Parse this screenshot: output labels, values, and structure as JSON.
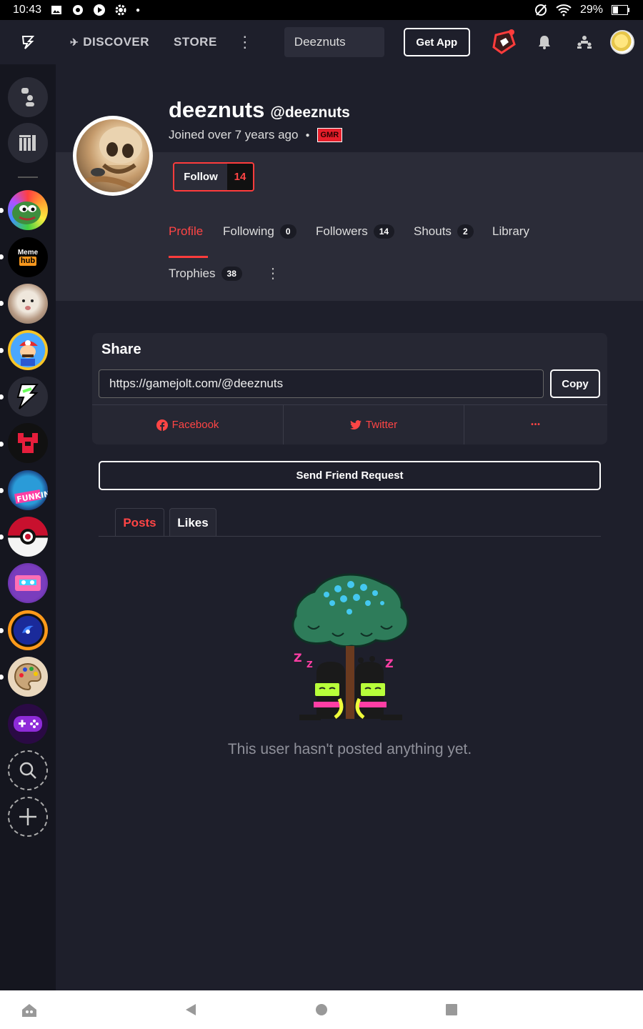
{
  "status_bar": {
    "time": "10:43",
    "battery": "29%"
  },
  "top_nav": {
    "discover_label": "DISCOVER",
    "store_label": "STORE",
    "search_value": "Deeznuts",
    "get_app_label": "Get App"
  },
  "sidebar": {
    "items": [
      {
        "name": "Meme hub",
        "label_line1": "Meme",
        "label_line2": "hub"
      }
    ]
  },
  "profile": {
    "display_name": "deeznuts",
    "handle": "@deeznuts",
    "joined": "Joined over 7 years ago",
    "badge": "GMR",
    "follow_label": "Follow",
    "follow_count": "14"
  },
  "profile_tabs": [
    {
      "label": "Profile",
      "count": null
    },
    {
      "label": "Following",
      "count": "0"
    },
    {
      "label": "Followers",
      "count": "14"
    },
    {
      "label": "Shouts",
      "count": "2"
    },
    {
      "label": "Library",
      "count": null
    },
    {
      "label": "Trophies",
      "count": "38"
    }
  ],
  "share": {
    "title": "Share",
    "url": "https://gamejolt.com/@deeznuts",
    "copy_label": "Copy",
    "facebook_label": "Facebook",
    "twitter_label": "Twitter",
    "more_label": "•••"
  },
  "friend_request_label": "Send Friend Request",
  "feed_tabs": [
    {
      "label": "Posts"
    },
    {
      "label": "Likes"
    }
  ],
  "empty_message": "This user hasn't posted anything yet.",
  "colors": {
    "accent": "#ff3c3c",
    "bg": "#1e1f2b",
    "band": "#2b2c38"
  }
}
